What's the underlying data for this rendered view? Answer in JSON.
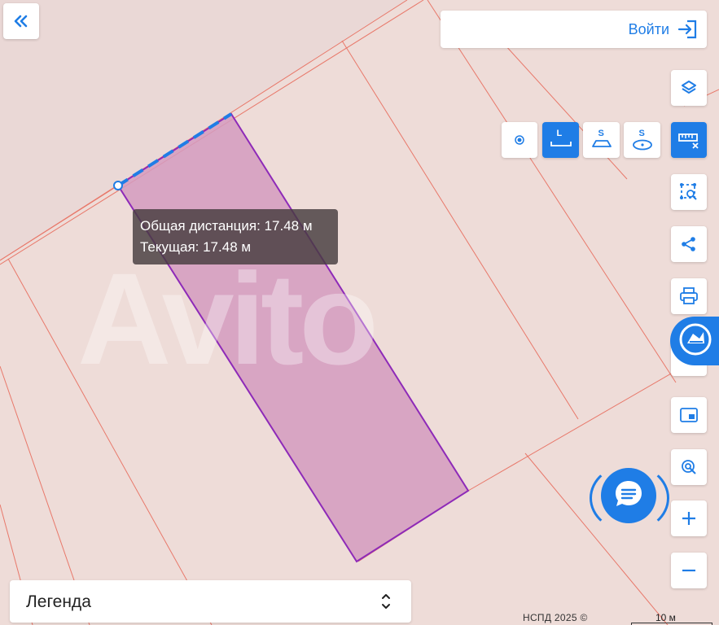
{
  "map": {
    "background_color": "#eedcd8",
    "parcel_line_color": "#e8786a",
    "selected_parcel_fill": "#d49bbf",
    "selected_parcel_stroke": "#8e2ab8",
    "measure_line_color": "#1f7de6"
  },
  "header": {
    "collapse_icon": "double-chevron-left-icon",
    "login_label": "Войти",
    "login_icon": "sign-in-icon"
  },
  "tooltip": {
    "total_distance": "Общая дистанция: 17.48 м",
    "current_distance": "Текущая: 17.48 м"
  },
  "measure_tools": [
    {
      "name": "point",
      "icon": "point-icon",
      "active": false
    },
    {
      "name": "line",
      "icon": "line-L-icon",
      "label": "L",
      "active": true
    },
    {
      "name": "area",
      "icon": "area-S-icon",
      "label": "S",
      "active": false
    },
    {
      "name": "circle-area",
      "icon": "circle-S-icon",
      "label": "S",
      "active": false
    }
  ],
  "right_toolbar": [
    {
      "name": "layers",
      "icon": "layers-icon"
    },
    {
      "name": "ruler",
      "icon": "ruler-close-icon",
      "active": true
    },
    {
      "name": "select-area",
      "icon": "select-area-icon"
    },
    {
      "name": "share",
      "icon": "share-icon"
    },
    {
      "name": "print",
      "icon": "print-icon"
    },
    {
      "name": "minimap",
      "icon": "minimap-icon"
    },
    {
      "name": "locate",
      "icon": "locate-icon"
    },
    {
      "name": "zoom-in",
      "icon": "plus-icon"
    },
    {
      "name": "zoom-out",
      "icon": "minus-icon"
    }
  ],
  "legend": {
    "label": "Легенда",
    "icon": "chevron-up-down-icon"
  },
  "footer": {
    "attribution": "НСПД 2025 ©",
    "scale_label": "10 м"
  },
  "watermark": "Avito",
  "accent_color": "#1f7de6"
}
